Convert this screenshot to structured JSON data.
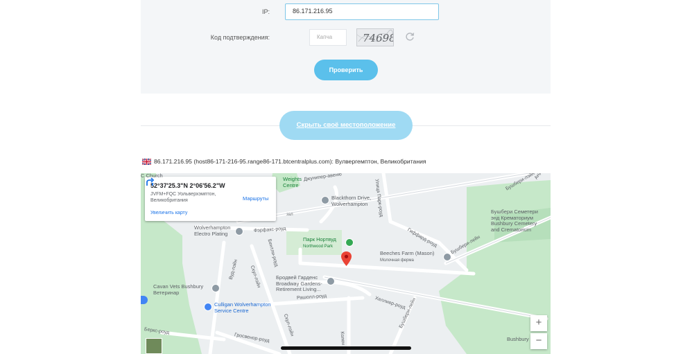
{
  "form": {
    "ip_label": "IP:",
    "ip_value": "86.171.216.95",
    "captcha_label": "Код подтверждения:",
    "captcha_placeholder": "Капча",
    "captcha_text": "74698",
    "refresh_icon": "refresh-icon",
    "check_button": "Проверить"
  },
  "hide_location_button": "Скрыть своё местоположение",
  "host_info": {
    "flag_icon": "uk-flag-icon",
    "text": "86.171.216.95 (host86-171-216-95.range86-171.btcentralplus.com): Вулвергемптон, Великобритания"
  },
  "map": {
    "infobox": {
      "coords": "52°37'25.3\"N 2°06'56.2\"W",
      "address": "JVFM+FQC Уольверхэмптон, Великобритания",
      "enlarge_link": "Увеличить карту",
      "routes_label": "Маршруты"
    },
    "labels": {
      "c_church": "C Church",
      "weights_centre_1": "Weights",
      "weights_centre_2": "Centre",
      "dzhuniper": "Джунипер-авеню",
      "blackthorn_1": "Blackthorn Drive,",
      "blackthorn_2": "Wolverhampton",
      "zal": "зал",
      "wolverhampton_electro_1": "Wolverhampton",
      "wolverhampton_electro_2": "Electro Plating",
      "fairfax": "Фэрфакс-роуд",
      "park_ru": "Парк Нортвуд",
      "park_en": "Northwood Park",
      "beeches_1": "Beeches Farm (Mason)",
      "beeches_2": "Молочная ферма",
      "broadway_1": "Бродвей Гарденс",
      "broadway_2": "Broadway Gardens-",
      "broadway_3": "Retirement Living...",
      "cavan_1": "Cavan Vets Bushbury",
      "cavan_2": "Ветеринар",
      "culligan_1": "Culligan Wolverhampton",
      "culligan_2": "Service Centre",
      "bushbury_cem_1": "Бушбери Семетери",
      "bushbury_cem_2": "энд Крематориум",
      "bushbury_cem_3": "Bushbury Cemetery",
      "bushbury_cem_4": "and Crematorium",
      "bushbury": "Bushbury",
      "berwick": "Беркс-роуд",
      "grosvenor": "Гросвенор-роуд",
      "rashall": "Рашолл-роуд",
      "hellier": "Хеллиер-роуд",
      "giffard": "Гиффард-роуд",
      "bushbury_lane": "Бушбери-лейн",
      "bushbury_lane_2": "Бушбери-лейн",
      "vud_lane": "Вуд-лэйн",
      "skul_lane": "Скул-лэйн",
      "skul_lane_2": "Скул-лэйн",
      "bentley": "Бентли-роуд",
      "oak_park": "Улица Парк-роуд",
      "ander": "Андер",
      "kolen": "Колен",
      "bushbury_top": "Бушбери-лэйн"
    },
    "zoom_in": "+",
    "zoom_out": "−",
    "marker_icon": "map-pin-icon"
  }
}
